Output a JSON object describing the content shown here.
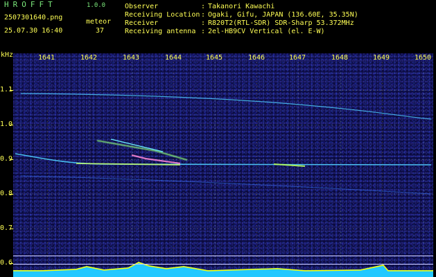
{
  "header": {
    "app_name": "HROFFT",
    "version": "1.0.0",
    "file_name": "2507301640.png",
    "datetime": "25.07.30 16:40",
    "meteor_label": "meteor",
    "meteor_count": "37"
  },
  "info": [
    {
      "label": "Observer",
      "value": "Takanori Kawachi"
    },
    {
      "label": "Receiving Location",
      "value": "Ogaki, Gifu, JAPAN (136.60E, 35.35N)"
    },
    {
      "label": "Receiver",
      "value": "R820T2(RTL-SDR) SDR-Sharp 53.372MHz"
    },
    {
      "label": "Receiving antenna",
      "value": "2el-HB9CV Vertical (el. E-W)"
    }
  ],
  "colon": ":",
  "axis": {
    "freq_unit": "kHz",
    "time_ticks": [
      "1641",
      "1642",
      "1643",
      "1644",
      "1645",
      "1646",
      "1647",
      "1648",
      "1649",
      "1650"
    ],
    "freq_ticks": [
      "1.1",
      "1.0",
      "0.9",
      "0.8",
      "0.7",
      "0.6"
    ]
  },
  "colors": {
    "header_green": "#7be87b",
    "text_yellow": "#ffff55",
    "background_blue": "#0a0a3a",
    "carrier_trace": "#4fd1ff",
    "meteor_trace": "#8fff7a",
    "level_trace": "#ffff00",
    "level_fill": "#22c8ff"
  }
}
